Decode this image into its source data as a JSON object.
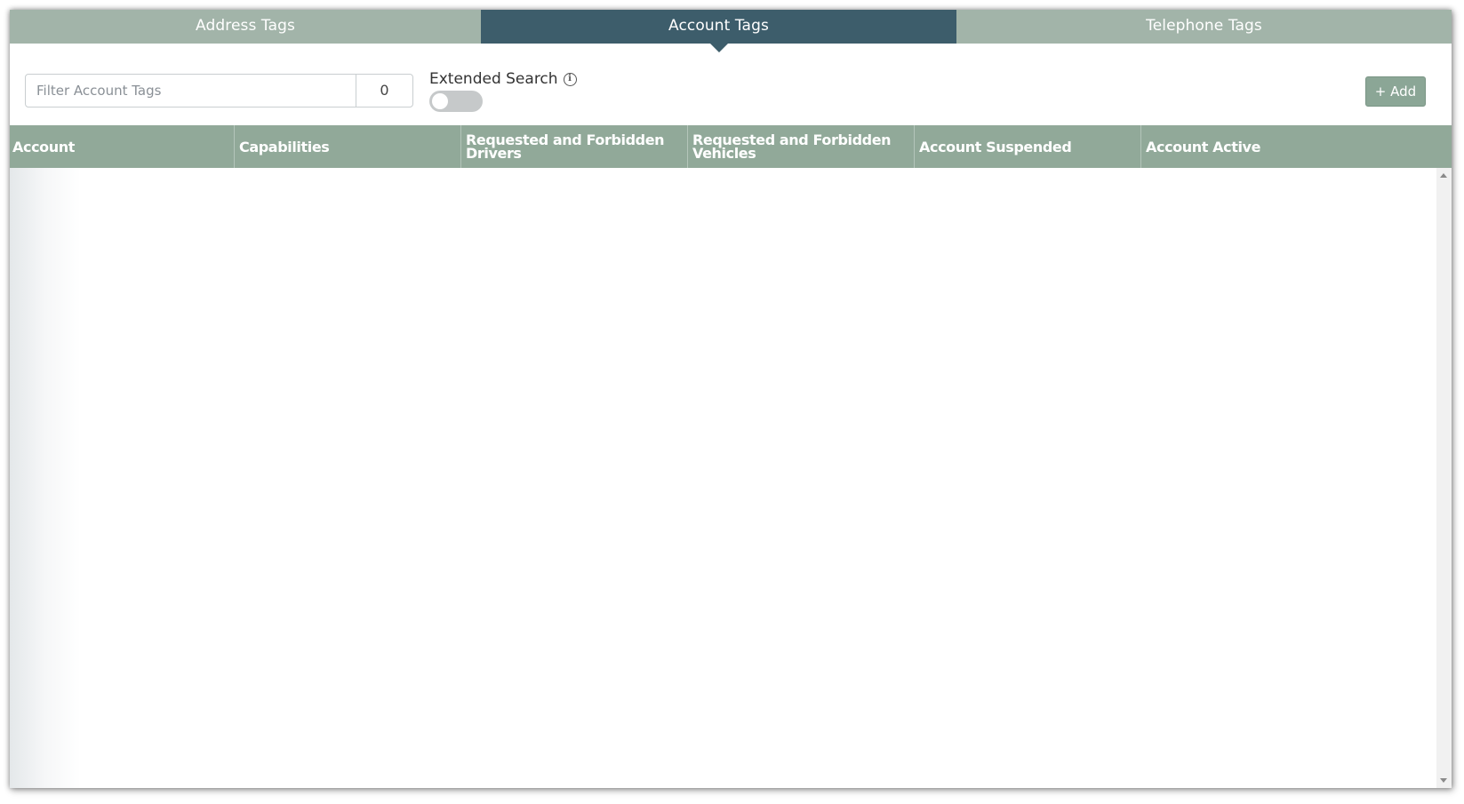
{
  "tabs": [
    {
      "label": "Address Tags",
      "active": false
    },
    {
      "label": "Account Tags",
      "active": true
    },
    {
      "label": "Telephone Tags",
      "active": false
    }
  ],
  "filter": {
    "placeholder": "Filter Account Tags",
    "value": "",
    "count": "0"
  },
  "extended_search": {
    "label": "Extended Search",
    "info_icon": "info-circle-icon",
    "enabled": false
  },
  "toolbar": {
    "add_label": "+ Add"
  },
  "table": {
    "columns": [
      "Account",
      "Capabilities",
      "Requested and Forbidden Drivers",
      "Requested and Forbidden Vehicles",
      "Account Suspended",
      "Account Active"
    ],
    "rows": []
  },
  "colors": {
    "tab_inactive": "#a2b4a9",
    "tab_active": "#3d5d6b",
    "header_bg": "#91a999",
    "add_button": "#8ba696"
  }
}
